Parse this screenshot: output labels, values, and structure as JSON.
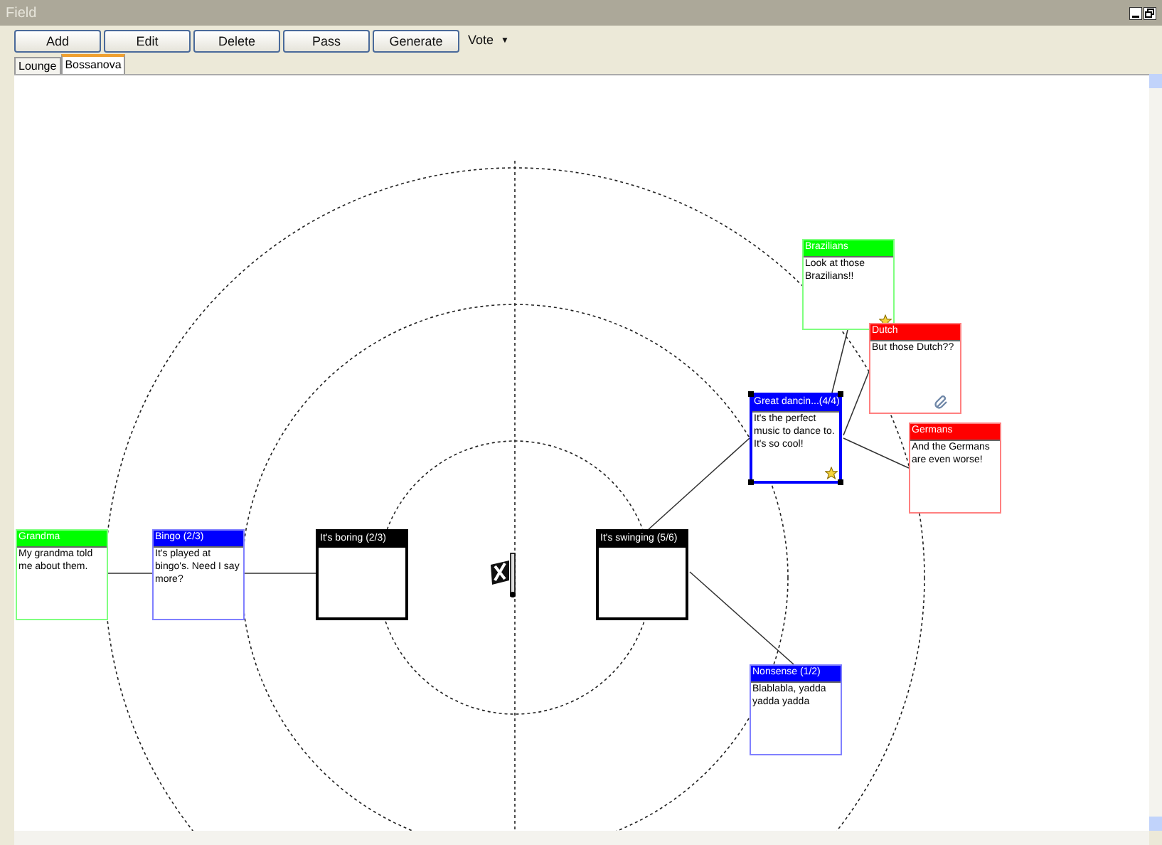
{
  "window": {
    "title": "Field"
  },
  "toolbar": {
    "buttons": [
      "Add",
      "Edit",
      "Delete",
      "Pass",
      "Generate"
    ],
    "vote": {
      "label": "Vote",
      "arrow": "▼"
    }
  },
  "tabs": [
    {
      "label": "Lounge",
      "selected": false
    },
    {
      "label": "Bossanova",
      "selected": true
    }
  ],
  "nodes": [
    {
      "title": "Brazilians",
      "body": "Look at those Brazilians!!",
      "color": "#00ff00",
      "selected": false,
      "starred": true,
      "attachment": false
    },
    {
      "title": "Dutch",
      "body": "But those Dutch??",
      "color": "#ff0000",
      "selected": false,
      "starred": false,
      "attachment": true
    },
    {
      "title": "Great dancin...(4/4)",
      "body": "It's the perfect music to dance to. It's so cool!",
      "color": "#0000ff",
      "selected": true,
      "starred": true,
      "attachment": false
    },
    {
      "title": "Germans",
      "body": "And the Germans are even worse!",
      "color": "#ff0000",
      "selected": false,
      "starred": false,
      "attachment": false
    },
    {
      "title": "Grandma",
      "body": "My grandma told me about them.",
      "color": "#00ff00",
      "selected": false,
      "starred": false,
      "attachment": false
    },
    {
      "title": "Bingo (2/3)",
      "body": "It's played at bingo's. Need I say more?",
      "color": "#0000ff",
      "selected": false,
      "starred": false,
      "attachment": false
    },
    {
      "title": "It's boring (2/3)",
      "color": "#000000",
      "selected": false,
      "starred": false,
      "attachment": false
    },
    {
      "title": "It's swinging (5/6)",
      "color": "#000000",
      "selected": false,
      "starred": false,
      "attachment": false
    },
    {
      "title": "Nonsense (1/2)",
      "body": "Blablabla, yadda yadda yadda",
      "color": "#0000ff",
      "selected": false,
      "starred": false,
      "attachment": false
    }
  ]
}
